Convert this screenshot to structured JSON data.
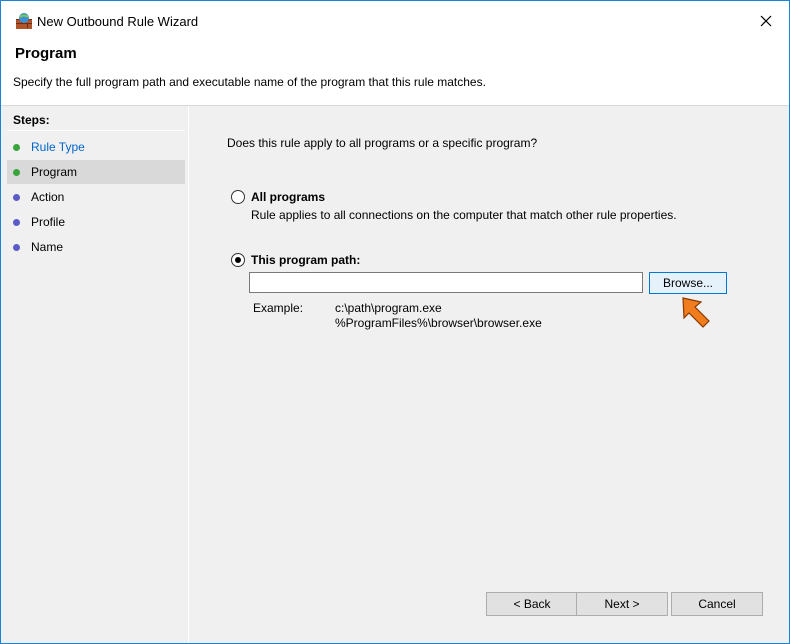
{
  "window": {
    "title": "New Outbound Rule Wizard",
    "close_glyph": "✕"
  },
  "header": {
    "title": "Program",
    "description": "Specify the full program path and executable name of the program that this rule matches."
  },
  "steps": {
    "heading": "Steps:",
    "items": [
      {
        "label": "Rule Type",
        "state": "done",
        "dot_color": "#3aa53a"
      },
      {
        "label": "Program",
        "state": "current",
        "dot_color": "#3aa53a"
      },
      {
        "label": "Action",
        "state": "pending",
        "dot_color": "#5a5ac8"
      },
      {
        "label": "Profile",
        "state": "pending",
        "dot_color": "#5a5ac8"
      },
      {
        "label": "Name",
        "state": "pending",
        "dot_color": "#5a5ac8"
      }
    ]
  },
  "main": {
    "question": "Does this rule apply to all programs or a specific program?",
    "option_all": {
      "label": "All programs",
      "description": "Rule applies to all connections on the computer that match other rule properties.",
      "selected": false
    },
    "option_path": {
      "label": "This program path:",
      "selected": true,
      "value": ""
    },
    "browse_label": "Browse...",
    "example_label": "Example:",
    "example_lines": [
      "c:\\path\\program.exe",
      "%ProgramFiles%\\browser\\browser.exe"
    ]
  },
  "footer": {
    "back_label": "< Back",
    "next_label": "Next >",
    "cancel_label": "Cancel"
  },
  "colors": {
    "accent": "#0078d7",
    "arrow": "#f07c1e",
    "link_step": "#0066cc"
  }
}
